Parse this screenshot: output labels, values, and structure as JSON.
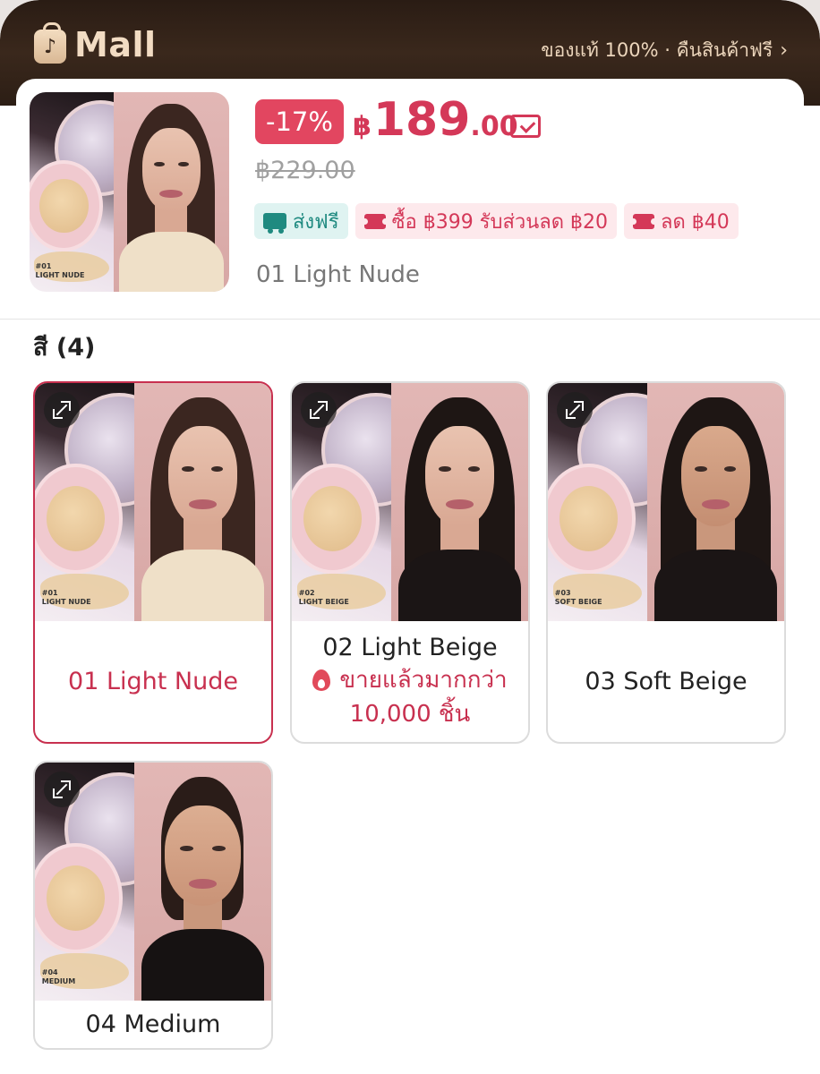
{
  "header": {
    "brand_label": "Mall",
    "tagline": "ของแท้ 100% · คืนสินค้าฟรี",
    "tagline_icon": "chevron-right-icon"
  },
  "product": {
    "discount": "-17%",
    "currency": "฿",
    "price_int": "189",
    "price_dec": ".00",
    "original_price": "฿229.00",
    "selected_variant": "01 Light Nude",
    "badges": [
      {
        "icon": "truck-icon",
        "label": "ส่งฟรี"
      },
      {
        "icon": "ticket-icon",
        "label": "ซื้อ ฿399 รับส่วนลด ฿20"
      },
      {
        "icon": "ticket-icon",
        "label": "ลด ฿40"
      }
    ]
  },
  "variants": {
    "title": "สี (4)",
    "items": [
      {
        "name": "01 Light Nude",
        "code": "#01",
        "shade": "LIGHT NUDE",
        "selected": true
      },
      {
        "name": "02 Light Beige",
        "code": "#02",
        "shade": "LIGHT BEIGE",
        "hot_line1": "ขายแล้วมากกว่า",
        "hot_line2": "10,000 ชิ้น"
      },
      {
        "name": "03 Soft Beige",
        "code": "#03",
        "shade": "SOFT BEIGE"
      },
      {
        "name": "04 Medium",
        "code": "#04",
        "shade": "MEDIUM"
      }
    ]
  },
  "colors": {
    "accent": "#d43858",
    "selected_border": "#c8304f",
    "header_bg": "#2a1c14",
    "header_text": "#f2dcc3",
    "shipping_badge": "#1f8a80"
  }
}
